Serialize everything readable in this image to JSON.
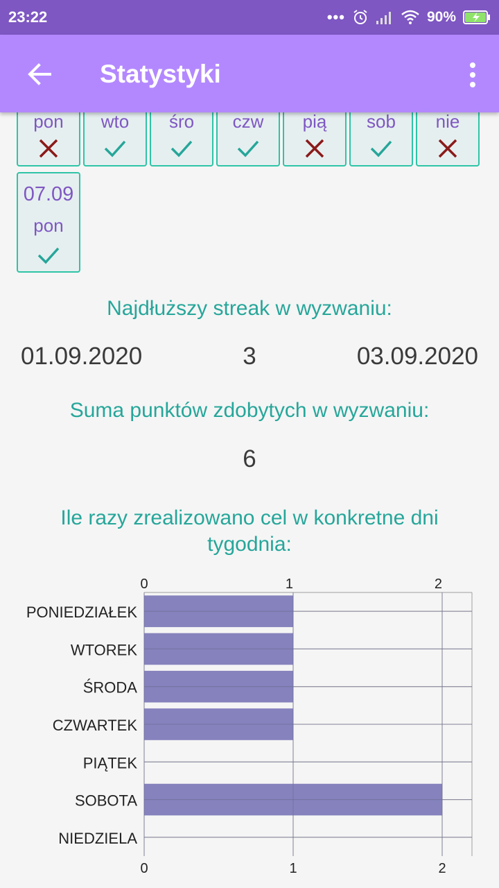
{
  "status_bar": {
    "time": "23:22",
    "battery": "90%"
  },
  "app_bar": {
    "title": "Statystyki"
  },
  "week_days": [
    {
      "label": "pon",
      "done": false
    },
    {
      "label": "wto",
      "done": true
    },
    {
      "label": "śro",
      "done": true
    },
    {
      "label": "czw",
      "done": true
    },
    {
      "label": "pią",
      "done": false
    },
    {
      "label": "sob",
      "done": true
    },
    {
      "label": "nie",
      "done": false
    }
  ],
  "extra_day": {
    "date": "07.09",
    "label": "pon",
    "done": true
  },
  "streak": {
    "title": "Najdłuższy streak w wyzwaniu:",
    "start": "01.09.2020",
    "length": "3",
    "end": "03.09.2020"
  },
  "points": {
    "title": "Suma punktów zdobytych w wyzwaniu:",
    "value": "6"
  },
  "weekday_chart": {
    "title_line1": "Ile razy zrealizowano cel w konkretne dni",
    "title_line2": "tygodnia:"
  },
  "colors": {
    "accent": "#7e57c2",
    "appbar": "#b388ff",
    "teal": "#26a69a",
    "cross": "#8b1a1a",
    "bar": "#7e7bb9"
  },
  "chart_data": {
    "type": "bar",
    "orientation": "horizontal",
    "categories": [
      "PONIEDZIAŁEK",
      "WTOREK",
      "ŚRODA",
      "CZWARTEK",
      "PIĄTEK",
      "SOBOTA",
      "NIEDZIELA"
    ],
    "values": [
      1,
      1,
      1,
      1,
      0,
      2,
      0
    ],
    "xlim": [
      0,
      2.2
    ],
    "xticks": [
      "0",
      "1",
      "2"
    ],
    "xticks_top": [
      "0",
      "1",
      "2"
    ],
    "grid": true,
    "legend": "none"
  }
}
